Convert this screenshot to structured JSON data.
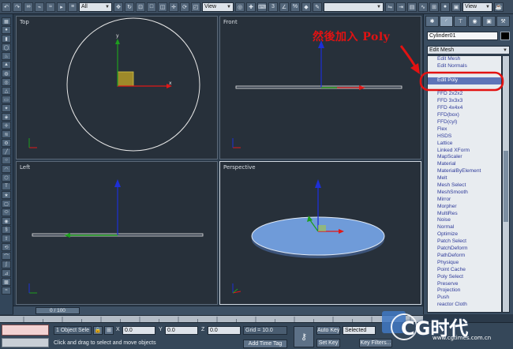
{
  "toolbar": {
    "selection_filter": "All",
    "ref_coord_1": "View",
    "ref_coord_2": "View",
    "named_selection": ""
  },
  "viewports": [
    {
      "label": "Top",
      "active": false
    },
    {
      "label": "Front",
      "active": false
    },
    {
      "label": "Left",
      "active": false
    },
    {
      "label": "Perspective",
      "active": true
    }
  ],
  "command_panel": {
    "object_name": "Cylinder01",
    "modifier_list_label": "Edit Mesh",
    "modifier_items": [
      "Edit Mesh",
      "Edit Normals",
      "",
      "Edit Poly",
      "",
      "FFD 2x2x2",
      "FFD 3x3x3",
      "FFD 4x4x4",
      "FFD(box)",
      "FFD(cyl)",
      "Flex",
      "HSDS",
      "Lattice",
      "Linked XForm",
      "MapScaler",
      "Material",
      "MaterialByElement",
      "Melt",
      "Mesh Select",
      "MeshSmooth",
      "Mirror",
      "Morpher",
      "MultiRes",
      "Noise",
      "Normal",
      "Optimize",
      "Patch Select",
      "PatchDeform",
      "PathDeform",
      "Physique",
      "Point Cache",
      "Poly Select",
      "Preserve",
      "Projection",
      "Push",
      "reactor Cloth",
      "",
      ""
    ],
    "highlighted_item": "Edit Poly"
  },
  "timeline": {
    "frame_display": "0 / 100"
  },
  "status": {
    "selection_count": "1 Object Sele",
    "prompt": "Click and drag to select and move objects",
    "x_label": "X",
    "x_value": "0.0",
    "y_label": "Y",
    "y_value": "0.0",
    "z_label": "Z",
    "z_value": "0.0",
    "grid": "Grid = 10.0",
    "add_time_tag": "Add Time Tag",
    "auto_key": "Auto Key",
    "set_key": "Set Key",
    "key_mode": "Selected",
    "key_filters": "Key Filters..."
  },
  "annotation": {
    "text": "然後加入 Poly",
    "color": "#e21212"
  },
  "watermark": {
    "logo": "CG时代",
    "url": "www.cgtimes.com.cn"
  },
  "colors": {
    "viewport_bg": "#27303a",
    "axis_x": "#e01818",
    "axis_y": "#1e9e1e",
    "axis_z": "#1d2fd6",
    "cylinder_fill": "#6f9bd9",
    "highlight": "#5e74b8"
  }
}
